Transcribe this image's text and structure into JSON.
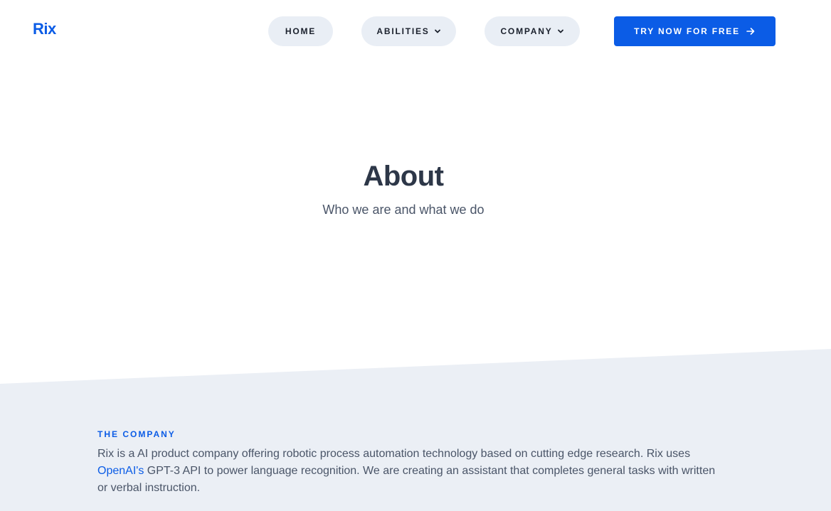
{
  "header": {
    "logo": "Rix",
    "nav": {
      "home": "HOME",
      "abilities": "ABILITIES",
      "company": "COMPANY"
    },
    "cta": "TRY NOW FOR FREE"
  },
  "hero": {
    "title": "About",
    "subtitle": "Who we are and what we do"
  },
  "company": {
    "eyebrow": "THE COMPANY",
    "text_before": "Rix is a AI product company offering robotic process automation technology based on cutting edge research. Rix uses ",
    "link": "OpenAI's",
    "text_after": " GPT-3 API to power language recognition. We are creating an assistant that completes general tasks with written or verbal instruction."
  },
  "colors": {
    "accent": "#0b5ce6",
    "pill_bg": "#e9eef5",
    "section_bg": "#ebeff5",
    "heading": "#2d3748",
    "body": "#4a5568"
  },
  "icons": {
    "nav_dropdown": "chevron-down-icon",
    "cta": "arrow-right-icon"
  }
}
